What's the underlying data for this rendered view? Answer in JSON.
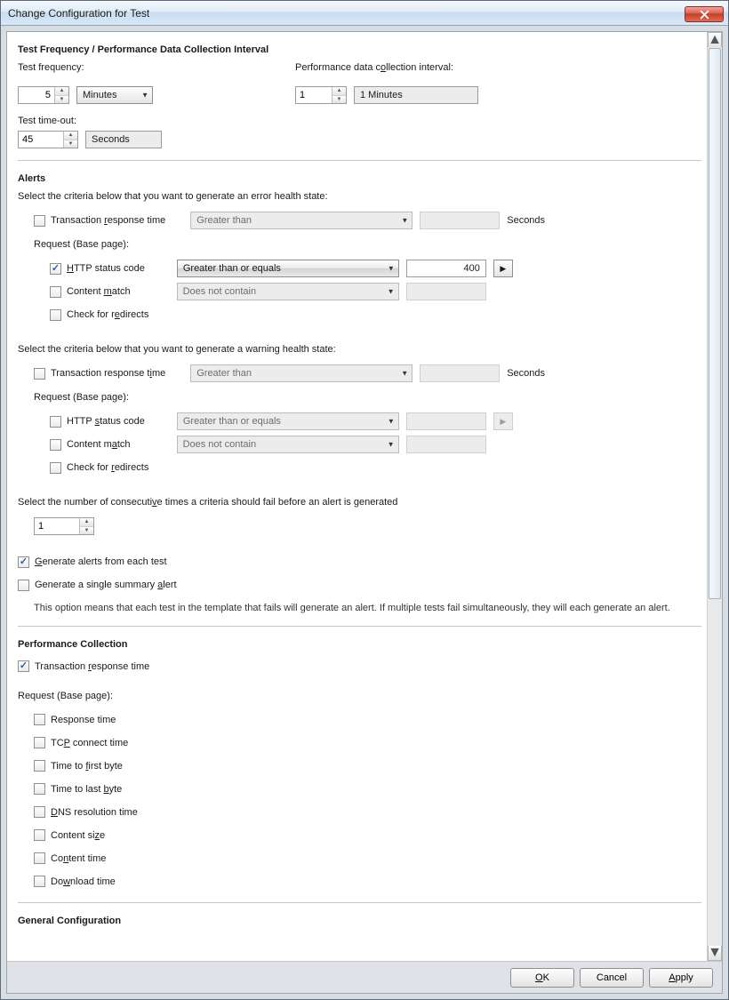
{
  "window": {
    "title": "Change Configuration for Test"
  },
  "section1": {
    "title": "Test Frequency / Performance Data Collection Interval",
    "freq_label": "Test frequency:",
    "freq_value": "5",
    "freq_unit_selected": "Minutes",
    "interval_label": "Performance data collection interval:",
    "interval_value": "1",
    "interval_display": "1 Minutes",
    "timeout_label": "Test time-out:",
    "timeout_value": "45",
    "timeout_unit": "Seconds"
  },
  "alerts": {
    "title": "Alerts",
    "error_desc": "Select the criteria below that you want to generate an error health state:",
    "warn_desc": "Select the criteria below that you want to generate a warning health state:",
    "trt_label": "Transaction response time",
    "trt_op": "Greater than",
    "trt_unit": "Seconds",
    "req_label": "Request (Base page):",
    "http_label": "HTTP status code",
    "http_op": "Greater than or equals",
    "http_val": "400",
    "cm_label": "Content match",
    "cm_op": "Does not contain",
    "redir_label": "Check for redirects",
    "consec_desc": "Select the number of consecutive times a criteria should fail before an alert is generated",
    "consec_val": "1",
    "gen_each": "Generate alerts from each test",
    "gen_summary": "Generate a single summary alert",
    "note": "This option means that each test in the template that fails will generate an alert. If multiple tests fail simultaneously, they will each generate an alert."
  },
  "perf": {
    "title": "Performance Collection",
    "trt": "Transaction response time",
    "req_label": "Request (Base page):",
    "items": {
      "rt": "Response time",
      "tcp": "TCP connect time",
      "ttfb": "Time to first byte",
      "ttlb": "Time to last byte",
      "dns": "DNS resolution time",
      "cs": "Content size",
      "ct": "Content time",
      "dl": "Download time"
    }
  },
  "general": {
    "title": "General Configuration"
  },
  "buttons": {
    "ok": "OK",
    "cancel": "Cancel",
    "apply": "Apply"
  }
}
